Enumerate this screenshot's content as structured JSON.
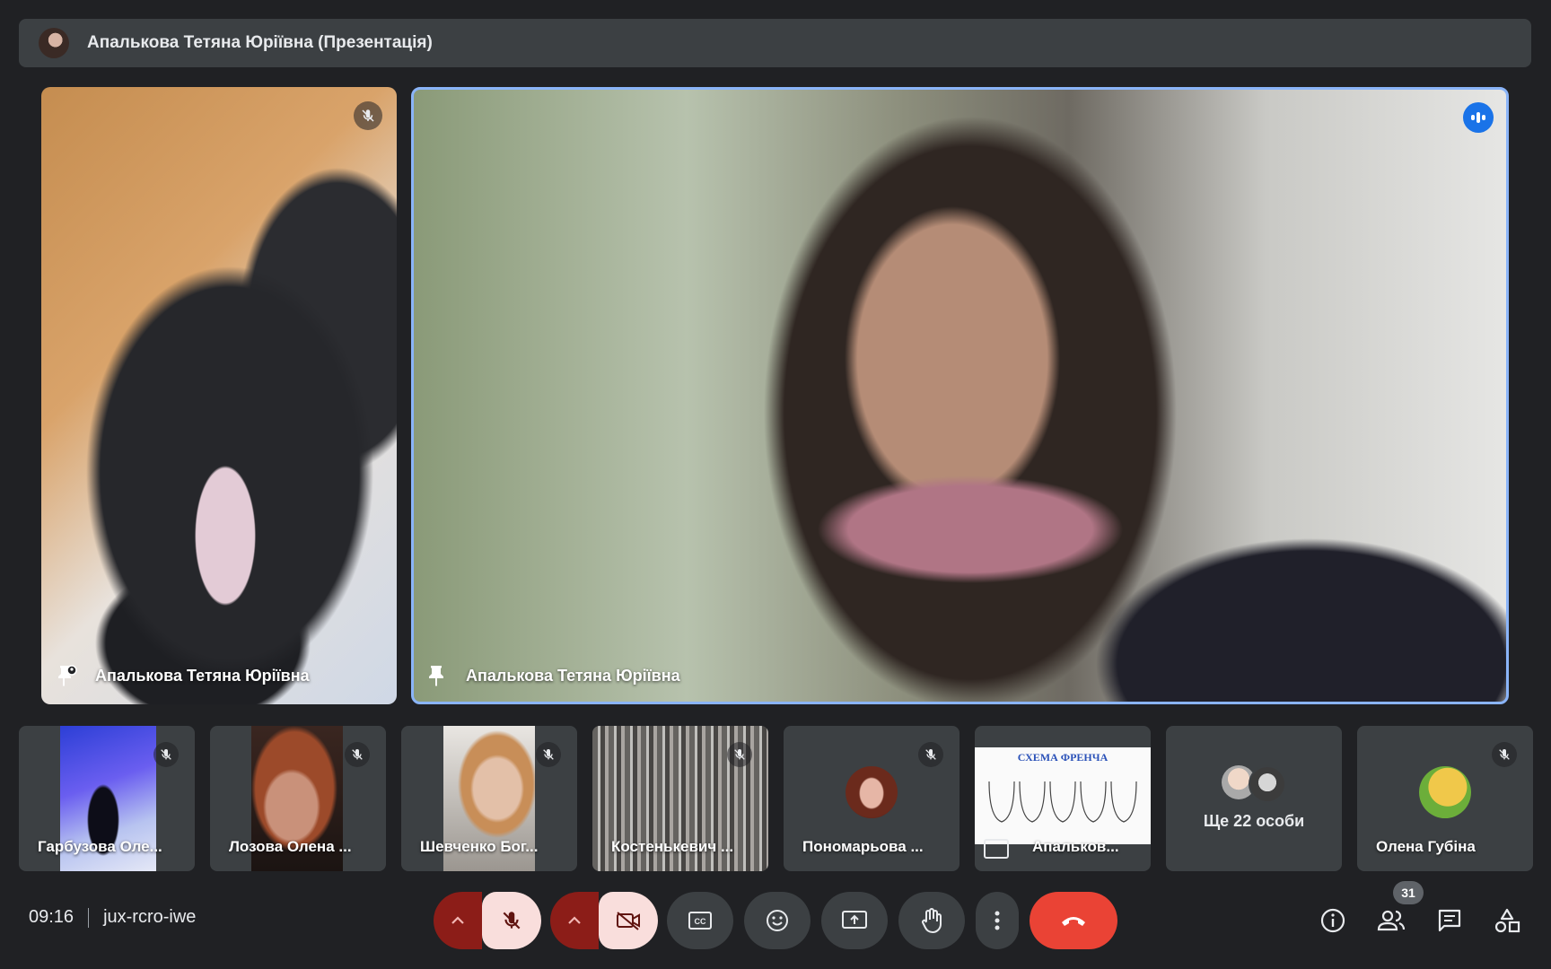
{
  "banner": {
    "title": "Апалькова Тетяна Юріївна (Презентація)"
  },
  "tiles": {
    "left": {
      "name": "Апалькова Тетяна Юріївна"
    },
    "main": {
      "name": "Апалькова Тетяна Юріївна"
    }
  },
  "thumbs": [
    {
      "name": "Гарбузова Оле..."
    },
    {
      "name": "Лозова Олена ..."
    },
    {
      "name": "Шевченко Бог..."
    },
    {
      "name": "Костенькевич ..."
    },
    {
      "name": "Пономарьова ..."
    },
    {
      "name": "Апальков...",
      "slide_title": "СХЕМА ФРЕНЧА"
    },
    {
      "name": "Ще 22 особи"
    },
    {
      "name": "Олена Губіна"
    }
  ],
  "bottom": {
    "time": "09:16",
    "meeting_code": "jux-rcro-iwe",
    "participant_count": "31"
  },
  "icons": [
    "mic-off-icon",
    "camera-off-icon",
    "captions-icon",
    "emoji-icon",
    "present-icon",
    "raise-hand-icon",
    "more-icon",
    "end-call-icon",
    "info-icon",
    "people-icon",
    "chat-icon",
    "activities-icon",
    "pin-icon",
    "speaking-icon"
  ],
  "colors": {
    "accent": "#8ab4f8",
    "end_call": "#ea4335",
    "muted_control": "#8c1d18",
    "muted_control_main": "#f9dedc"
  }
}
